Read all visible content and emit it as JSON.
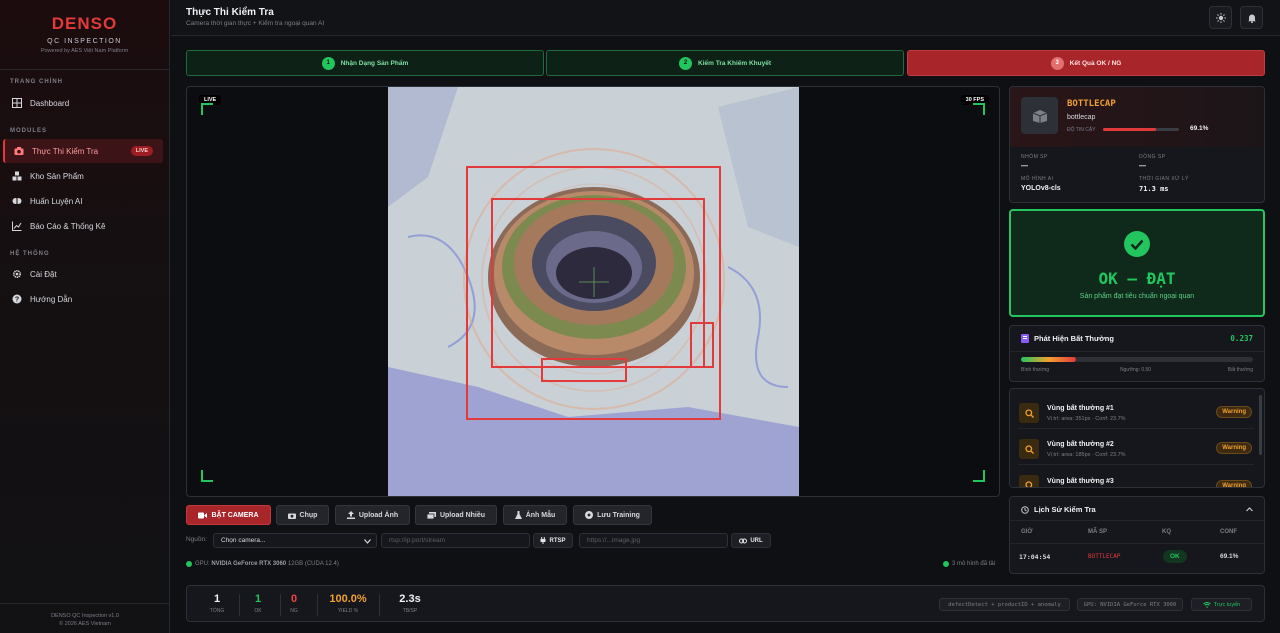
{
  "sidebar": {
    "brand": "DENSO",
    "brand_sub": "QC INSPECTION",
    "powered": "Powered by AES Việt Nam Platform",
    "sections": [
      "TRANG CHÍNH",
      "MODULES",
      "HỆ THỐNG"
    ],
    "items": [
      {
        "label": "Dashboard",
        "icon": "grid-icon"
      },
      {
        "label": "Thực Thi Kiểm Tra",
        "icon": "camera-icon",
        "badge": "LIVE"
      },
      {
        "label": "Kho Sản Phẩm",
        "icon": "boxes-icon"
      },
      {
        "label": "Huấn Luyện AI",
        "icon": "brain-icon"
      },
      {
        "label": "Báo Cáo & Thống Kê",
        "icon": "chart-icon"
      },
      {
        "label": "Cài Đặt",
        "icon": "gear-icon"
      },
      {
        "label": "Hướng Dẫn",
        "icon": "help-icon"
      }
    ],
    "footer1": "DENSO QC Inspection v1.0",
    "footer2": "© 2026 AES Vietnam"
  },
  "header": {
    "title": "Thực Thi Kiểm Tra",
    "subtitle": "Camera thời gian thực + Kiểm tra ngoại quan AI"
  },
  "steps": [
    {
      "num": "1",
      "label": "Nhận Dạng Sản Phẩm"
    },
    {
      "num": "2",
      "label": "Kiểm Tra Khiếm Khuyết"
    },
    {
      "num": "3",
      "label": "Kết Quả OK / NG"
    }
  ],
  "viewer": {
    "live": "LIVE",
    "fps": "30 FPS"
  },
  "actions": {
    "camera": "BẬT CAMERA",
    "capture": "Chụp",
    "upload": "Upload Ảnh",
    "upload_multi": "Upload Nhiều",
    "sample": "Ảnh Mẫu",
    "save_training": "Lưu Training"
  },
  "source": {
    "label": "Nguồn:",
    "camera_select": "Chọn camera...",
    "rtsp_placeholder": "rtsp://ip:port/stream",
    "rtsp_btn": "RTSP",
    "url_placeholder": "https://...image.jpg",
    "url_btn": "URL"
  },
  "gpu_line": {
    "prefix": "GPU:",
    "name": "NVIDIA GeForce RTX 3060",
    "detail": "12GB (CUDA 12.4)"
  },
  "models_loaded": "3 mô hình đã tải",
  "stats": [
    {
      "value": "1",
      "label": "TỔNG",
      "color": "#f0f1f4"
    },
    {
      "value": "1",
      "label": "OK",
      "color": "#22c55e"
    },
    {
      "value": "0",
      "label": "NG",
      "color": "#ef4444"
    },
    {
      "value": "100.0%",
      "label": "YIELD %",
      "color": "#f0a030"
    },
    {
      "value": "2.3s",
      "label": "TB/SP",
      "color": "#f0f1f4"
    }
  ],
  "footer_chips": {
    "pipeline": "defectDetect + productID + anomaly",
    "gpu": "GPU: NVIDIA GeForce RTX 3060",
    "online": "Trực tuyến"
  },
  "product": {
    "name": "BOTTLECAP",
    "sub": "bottlecap",
    "confidence_label": "ĐỘ TIN CẬY",
    "confidence": "69.1%",
    "confidence_value": 0.691,
    "group_label": "NHÓM SP",
    "group_value": "—",
    "line_label": "DÒNG SP",
    "line_value": "—",
    "model_label": "MÔ HÌNH AI",
    "model_value": "YOLOv8-cls",
    "time_label": "THỜI GIAN XỬ LÝ",
    "time_value": "71.3 ms"
  },
  "result": {
    "title": "OK — ĐẠT",
    "desc": "Sản phẩm đạt tiêu chuẩn ngoại quan"
  },
  "anomaly": {
    "title": "Phát Hiện Bất Thường",
    "score": "0.237",
    "score_value": 0.237,
    "scale": [
      "Bình thường",
      "Ngưỡng: 0.50",
      "Bất thường"
    ]
  },
  "anomaly_regions": [
    {
      "name": "Vùng bất thường #1",
      "detail": "Vị trí: area: 351px · Conf: 23.7%",
      "status": "Warning"
    },
    {
      "name": "Vùng bất thường #2",
      "detail": "Vị trí: area: 185px · Conf: 23.7%",
      "status": "Warning"
    },
    {
      "name": "Vùng bất thường #3",
      "detail": "",
      "status": "Warning"
    }
  ],
  "history": {
    "title": "Lịch Sử Kiểm Tra",
    "headers": [
      "GIỜ",
      "MÃ SP",
      "KQ",
      "CONF"
    ],
    "rows": [
      {
        "time": "17:04:54",
        "code": "BOTTLECAP",
        "result": "OK",
        "conf": "69.1%"
      }
    ]
  }
}
